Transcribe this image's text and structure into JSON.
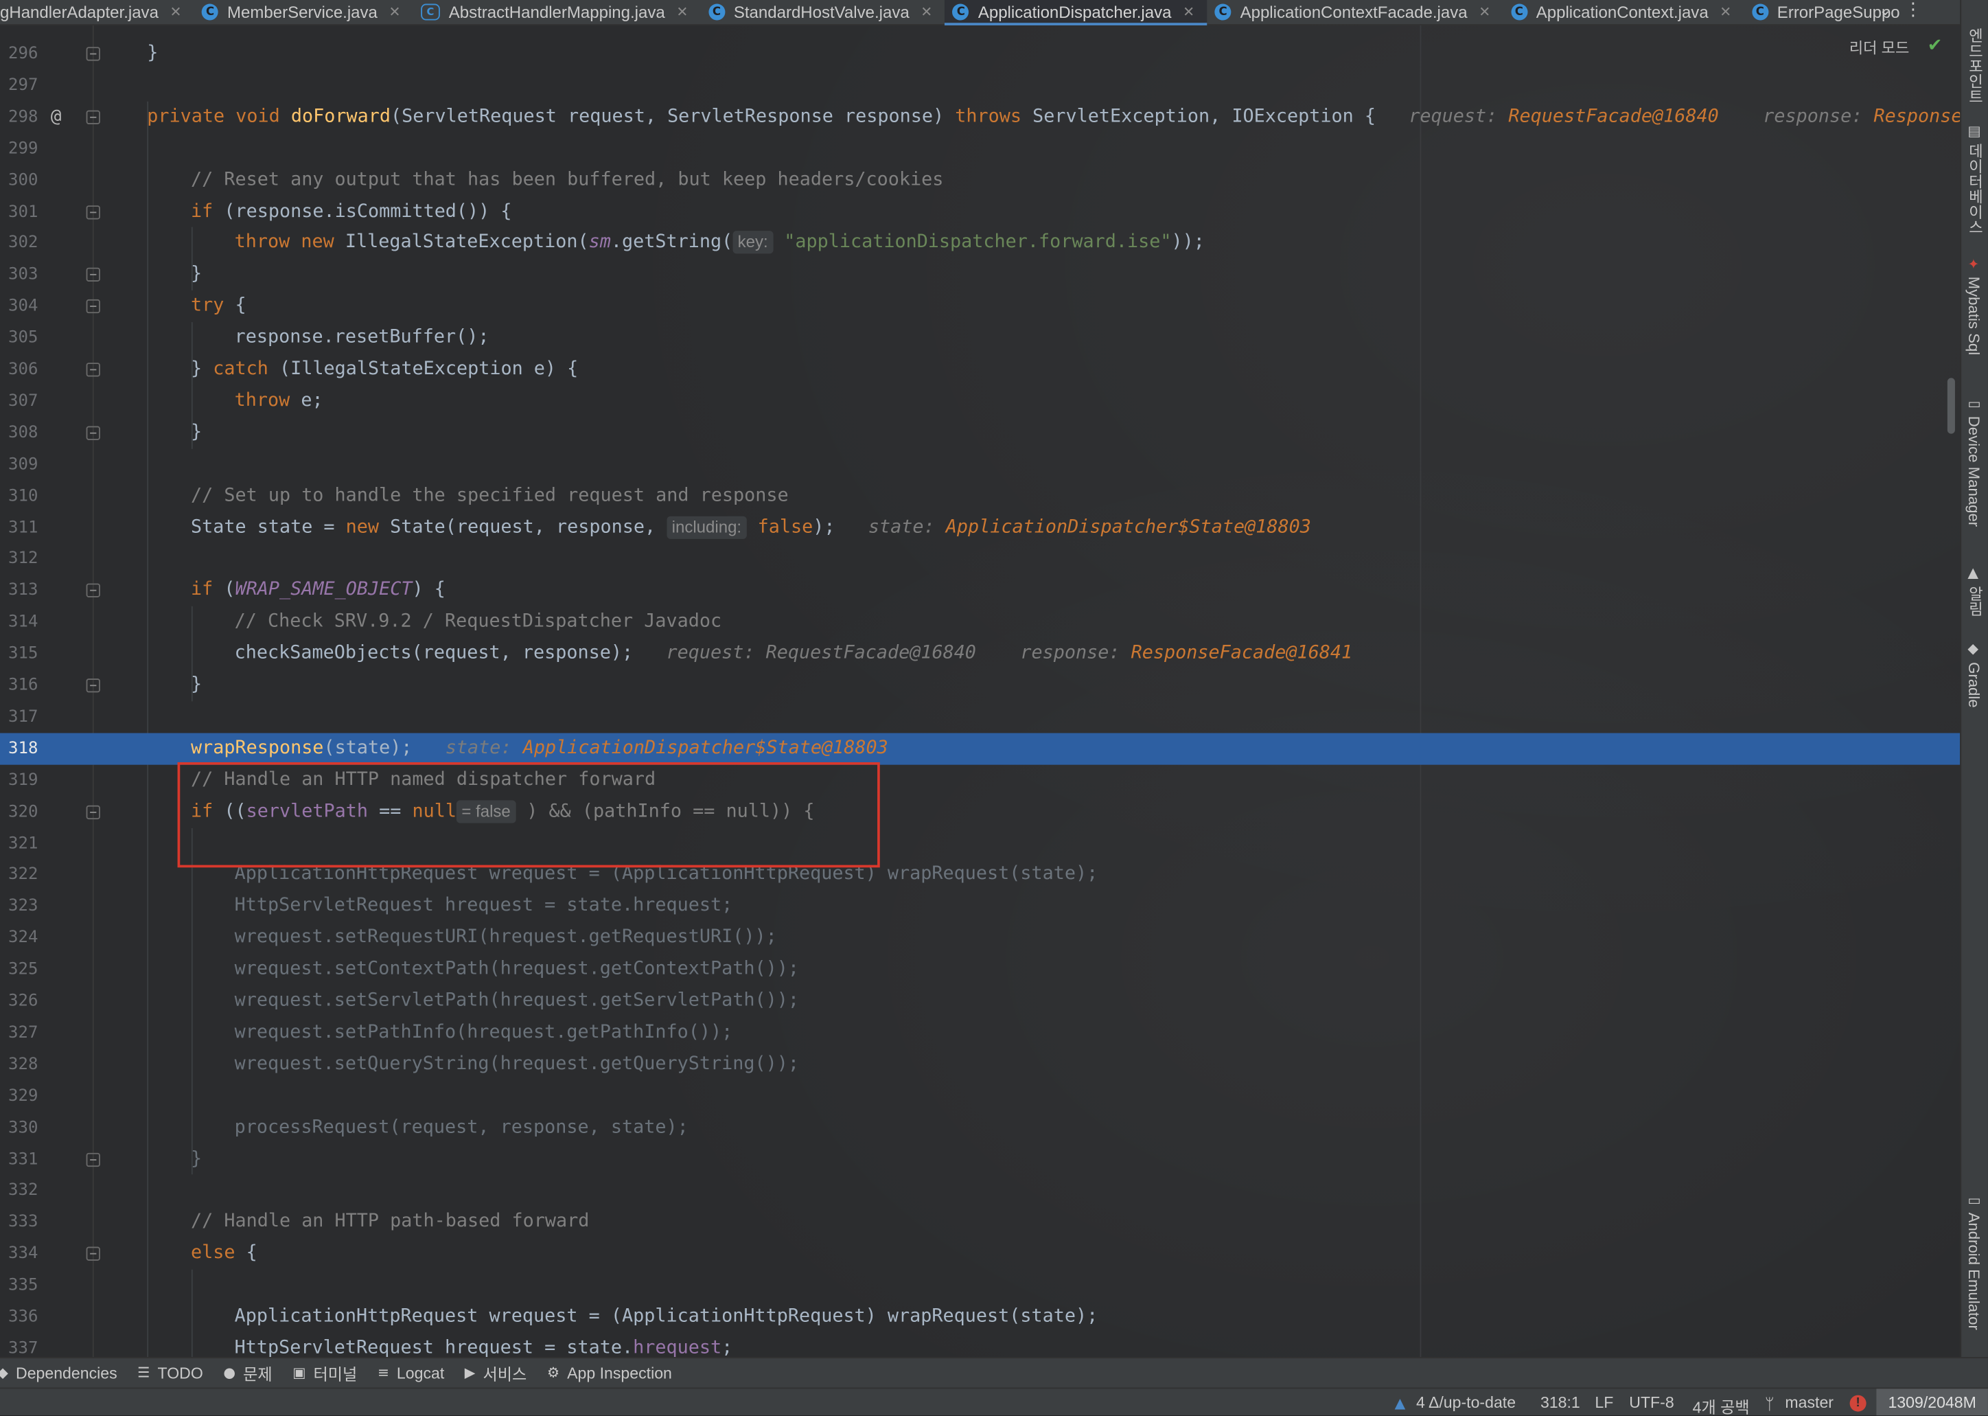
{
  "tabs": [
    {
      "label": "gHandlerAdapter.java",
      "icon": "none",
      "active": false
    },
    {
      "label": "MemberService.java",
      "icon": "class",
      "active": false
    },
    {
      "label": "AbstractHandlerMapping.java",
      "icon": "abstract",
      "active": false
    },
    {
      "label": "StandardHostValve.java",
      "icon": "class",
      "active": false
    },
    {
      "label": "ApplicationDispatcher.java",
      "icon": "class",
      "active": true
    },
    {
      "label": "ApplicationContextFacade.java",
      "icon": "class",
      "active": false
    },
    {
      "label": "ApplicationContext.java",
      "icon": "class",
      "active": false
    },
    {
      "label": "ErrorPageSuppo",
      "icon": "class",
      "active": false
    }
  ],
  "editor": {
    "reader_mode": "리더 모드",
    "current_line": 318,
    "lines": [
      {
        "n": 296,
        "fold": true,
        "indent": 0,
        "dim": false,
        "parts": [
          [
            "par",
            "}"
          ]
        ]
      },
      {
        "n": 297,
        "fold": false,
        "indent": 0,
        "dim": false,
        "parts": []
      },
      {
        "n": 298,
        "fold": true,
        "at": true,
        "indent": 0,
        "dim": false,
        "parts": [
          [
            "kw",
            "private void "
          ],
          [
            "fn",
            "doForward"
          ],
          [
            "par",
            "(ServletRequest request, ServletResponse response) "
          ],
          [
            "kw",
            "throws "
          ],
          [
            "par",
            "ServletException, IOException {"
          ],
          [
            "dbg",
            "   request: "
          ],
          [
            "dbgv",
            "RequestFacade@16840"
          ],
          [
            "dbg",
            "    response: "
          ],
          [
            "dbgv",
            "ResponseF"
          ]
        ]
      },
      {
        "n": 299,
        "fold": false,
        "indent": 0,
        "dim": false,
        "parts": []
      },
      {
        "n": 300,
        "fold": false,
        "indent": 1,
        "dim": false,
        "parts": [
          [
            "cm",
            "// Reset any output that has been buffered, but keep headers/cookies"
          ]
        ]
      },
      {
        "n": 301,
        "fold": true,
        "indent": 1,
        "dim": false,
        "parts": [
          [
            "kw",
            "if "
          ],
          [
            "par",
            "(response.isCommitted()) {"
          ]
        ]
      },
      {
        "n": 302,
        "fold": false,
        "indent": 2,
        "dim": false,
        "parts": [
          [
            "kw",
            "throw new "
          ],
          [
            "par",
            "IllegalStateException("
          ],
          [
            "st",
            "sm"
          ],
          [
            "par",
            ".getString("
          ],
          [
            "hint",
            "key:"
          ],
          [
            "str",
            " \"applicationDispatcher.forward.ise\""
          ],
          [
            "par",
            "));"
          ]
        ]
      },
      {
        "n": 303,
        "fold": true,
        "indent": 1,
        "dim": false,
        "parts": [
          [
            "par",
            "}"
          ]
        ]
      },
      {
        "n": 304,
        "fold": true,
        "indent": 1,
        "dim": false,
        "parts": [
          [
            "kw",
            "try "
          ],
          [
            "par",
            "{"
          ]
        ]
      },
      {
        "n": 305,
        "fold": false,
        "indent": 2,
        "dim": false,
        "parts": [
          [
            "par",
            "response.resetBuffer();"
          ]
        ]
      },
      {
        "n": 306,
        "fold": true,
        "indent": 1,
        "dim": false,
        "parts": [
          [
            "par",
            "} "
          ],
          [
            "kw",
            "catch "
          ],
          [
            "par",
            "(IllegalStateException e) {"
          ]
        ]
      },
      {
        "n": 307,
        "fold": false,
        "indent": 2,
        "dim": false,
        "parts": [
          [
            "kw",
            "throw "
          ],
          [
            "par",
            "e;"
          ]
        ]
      },
      {
        "n": 308,
        "fold": true,
        "indent": 1,
        "dim": false,
        "parts": [
          [
            "par",
            "}"
          ]
        ]
      },
      {
        "n": 309,
        "fold": false,
        "indent": 0,
        "dim": false,
        "parts": []
      },
      {
        "n": 310,
        "fold": false,
        "indent": 1,
        "dim": false,
        "parts": [
          [
            "cm",
            "// Set up to handle the specified request and response"
          ]
        ]
      },
      {
        "n": 311,
        "fold": false,
        "indent": 1,
        "dim": false,
        "parts": [
          [
            "par",
            "State state = "
          ],
          [
            "kw",
            "new "
          ],
          [
            "par",
            "State(request, response, "
          ],
          [
            "hint",
            "including:"
          ],
          [
            "kw",
            " false"
          ],
          [
            "par",
            ");"
          ],
          [
            "dbg",
            "   state: "
          ],
          [
            "dbgv",
            "ApplicationDispatcher$State@18803"
          ]
        ]
      },
      {
        "n": 312,
        "fold": false,
        "indent": 0,
        "dim": false,
        "parts": []
      },
      {
        "n": 313,
        "fold": true,
        "indent": 1,
        "dim": false,
        "parts": [
          [
            "kw",
            "if "
          ],
          [
            "par",
            "("
          ],
          [
            "st",
            "WRAP_SAME_OBJECT"
          ],
          [
            "par",
            ") {"
          ]
        ]
      },
      {
        "n": 314,
        "fold": false,
        "indent": 2,
        "dim": false,
        "parts": [
          [
            "cm",
            "// Check SRV.9.2 / RequestDispatcher Javadoc"
          ]
        ]
      },
      {
        "n": 315,
        "fold": false,
        "indent": 2,
        "dim": false,
        "parts": [
          [
            "par",
            "checkSameObjects(request, response);"
          ],
          [
            "dbg",
            "   request: RequestFacade@16840    response: "
          ],
          [
            "dbgv",
            "ResponseFacade@16841"
          ]
        ]
      },
      {
        "n": 316,
        "fold": true,
        "indent": 1,
        "dim": false,
        "parts": [
          [
            "par",
            "}"
          ]
        ]
      },
      {
        "n": 317,
        "fold": false,
        "indent": 0,
        "dim": false,
        "parts": []
      },
      {
        "n": 318,
        "fold": false,
        "indent": 1,
        "dim": false,
        "hl": true,
        "parts": [
          [
            "fn",
            "wrapResponse"
          ],
          [
            "par",
            "(state);"
          ],
          [
            "dbg",
            "   state: "
          ],
          [
            "dbgv",
            "ApplicationDispatcher$State@18803"
          ]
        ]
      },
      {
        "n": 319,
        "fold": false,
        "indent": 1,
        "dim": false,
        "parts": [
          [
            "cm",
            "// Handle an HTTP named dispatcher forward"
          ]
        ]
      },
      {
        "n": 320,
        "fold": true,
        "indent": 1,
        "dim": false,
        "parts": [
          [
            "kw",
            "if "
          ],
          [
            "par",
            "(("
          ],
          [
            "fd",
            "servletPath"
          ],
          [
            "par",
            " == "
          ],
          [
            "kw",
            "null"
          ],
          [
            "hint",
            "= false"
          ],
          [
            "cm",
            " ) && (pathInfo == null)) {"
          ]
        ]
      },
      {
        "n": 321,
        "fold": false,
        "indent": 0,
        "dim": false,
        "parts": []
      },
      {
        "n": 322,
        "fold": false,
        "indent": 2,
        "dim": true,
        "parts": [
          [
            "par",
            "ApplicationHttpRequest wrequest = (ApplicationHttpRequest) wrapRequest(state);"
          ]
        ]
      },
      {
        "n": 323,
        "fold": false,
        "indent": 2,
        "dim": true,
        "parts": [
          [
            "par",
            "HttpServletRequest hrequest = state.hrequest;"
          ]
        ]
      },
      {
        "n": 324,
        "fold": false,
        "indent": 2,
        "dim": true,
        "parts": [
          [
            "par",
            "wrequest.setRequestURI(hrequest.getRequestURI());"
          ]
        ]
      },
      {
        "n": 325,
        "fold": false,
        "indent": 2,
        "dim": true,
        "parts": [
          [
            "par",
            "wrequest.setContextPath(hrequest.getContextPath());"
          ]
        ]
      },
      {
        "n": 326,
        "fold": false,
        "indent": 2,
        "dim": true,
        "parts": [
          [
            "par",
            "wrequest.setServletPath(hrequest.getServletPath());"
          ]
        ]
      },
      {
        "n": 327,
        "fold": false,
        "indent": 2,
        "dim": true,
        "parts": [
          [
            "par",
            "wrequest.setPathInfo(hrequest.getPathInfo());"
          ]
        ]
      },
      {
        "n": 328,
        "fold": false,
        "indent": 2,
        "dim": true,
        "parts": [
          [
            "par",
            "wrequest.setQueryString(hrequest.getQueryString());"
          ]
        ]
      },
      {
        "n": 329,
        "fold": false,
        "indent": 0,
        "dim": true,
        "parts": []
      },
      {
        "n": 330,
        "fold": false,
        "indent": 2,
        "dim": true,
        "parts": [
          [
            "par",
            "processRequest(request, response, state);"
          ]
        ]
      },
      {
        "n": 331,
        "fold": true,
        "indent": 1,
        "dim": true,
        "parts": [
          [
            "par",
            "}"
          ]
        ]
      },
      {
        "n": 332,
        "fold": false,
        "indent": 0,
        "dim": false,
        "parts": []
      },
      {
        "n": 333,
        "fold": false,
        "indent": 1,
        "dim": false,
        "parts": [
          [
            "cm",
            "// Handle an HTTP path-based forward"
          ]
        ]
      },
      {
        "n": 334,
        "fold": true,
        "indent": 1,
        "dim": false,
        "parts": [
          [
            "kw",
            "else "
          ],
          [
            "par",
            "{"
          ]
        ]
      },
      {
        "n": 335,
        "fold": false,
        "indent": 0,
        "dim": false,
        "parts": []
      },
      {
        "n": 336,
        "fold": false,
        "indent": 2,
        "dim": false,
        "parts": [
          [
            "par",
            "ApplicationHttpRequest wrequest = (ApplicationHttpRequest) wrapRequest(state);"
          ]
        ]
      },
      {
        "n": 337,
        "fold": false,
        "indent": 2,
        "dim": false,
        "parts": [
          [
            "par",
            "HttpServletRequest hrequest = state."
          ],
          [
            "fd",
            "hrequest"
          ],
          [
            "par",
            ";"
          ]
        ]
      }
    ]
  },
  "right_bar": [
    {
      "label": "엔드포인트",
      "icon": "◇"
    },
    {
      "label": "데이터베이스",
      "icon": "▤"
    },
    {
      "label": "Mybatis Sql",
      "icon": "✦"
    },
    {
      "label": "Device Manager",
      "icon": "▭"
    },
    {
      "label": "알림",
      "icon": "🔔"
    },
    {
      "label": "Gradle",
      "icon": "◆"
    },
    {
      "label": "Android Emulator",
      "icon": "▭"
    }
  ],
  "bottom_tools": [
    {
      "label": "Dependencies",
      "icon": "◆"
    },
    {
      "label": "TODO",
      "icon": "☰"
    },
    {
      "label": "문제",
      "icon": "●"
    },
    {
      "label": "터미널",
      "icon": "▣"
    },
    {
      "label": "Logcat",
      "icon": "≡"
    },
    {
      "label": "서비스",
      "icon": "▶"
    },
    {
      "label": "App Inspection",
      "icon": "⚙"
    }
  ],
  "status": {
    "vcs": "4 Δ/up-to-date",
    "position": "318:1",
    "line_sep": "LF",
    "encoding": "UTF-8",
    "indent": "4개 공백",
    "branch": "master",
    "memory": "1309/2048M"
  },
  "colors": {
    "accent": "#4a88c7",
    "highlight_line": "#2d5fa2",
    "annotation_box": "#d9382c"
  }
}
